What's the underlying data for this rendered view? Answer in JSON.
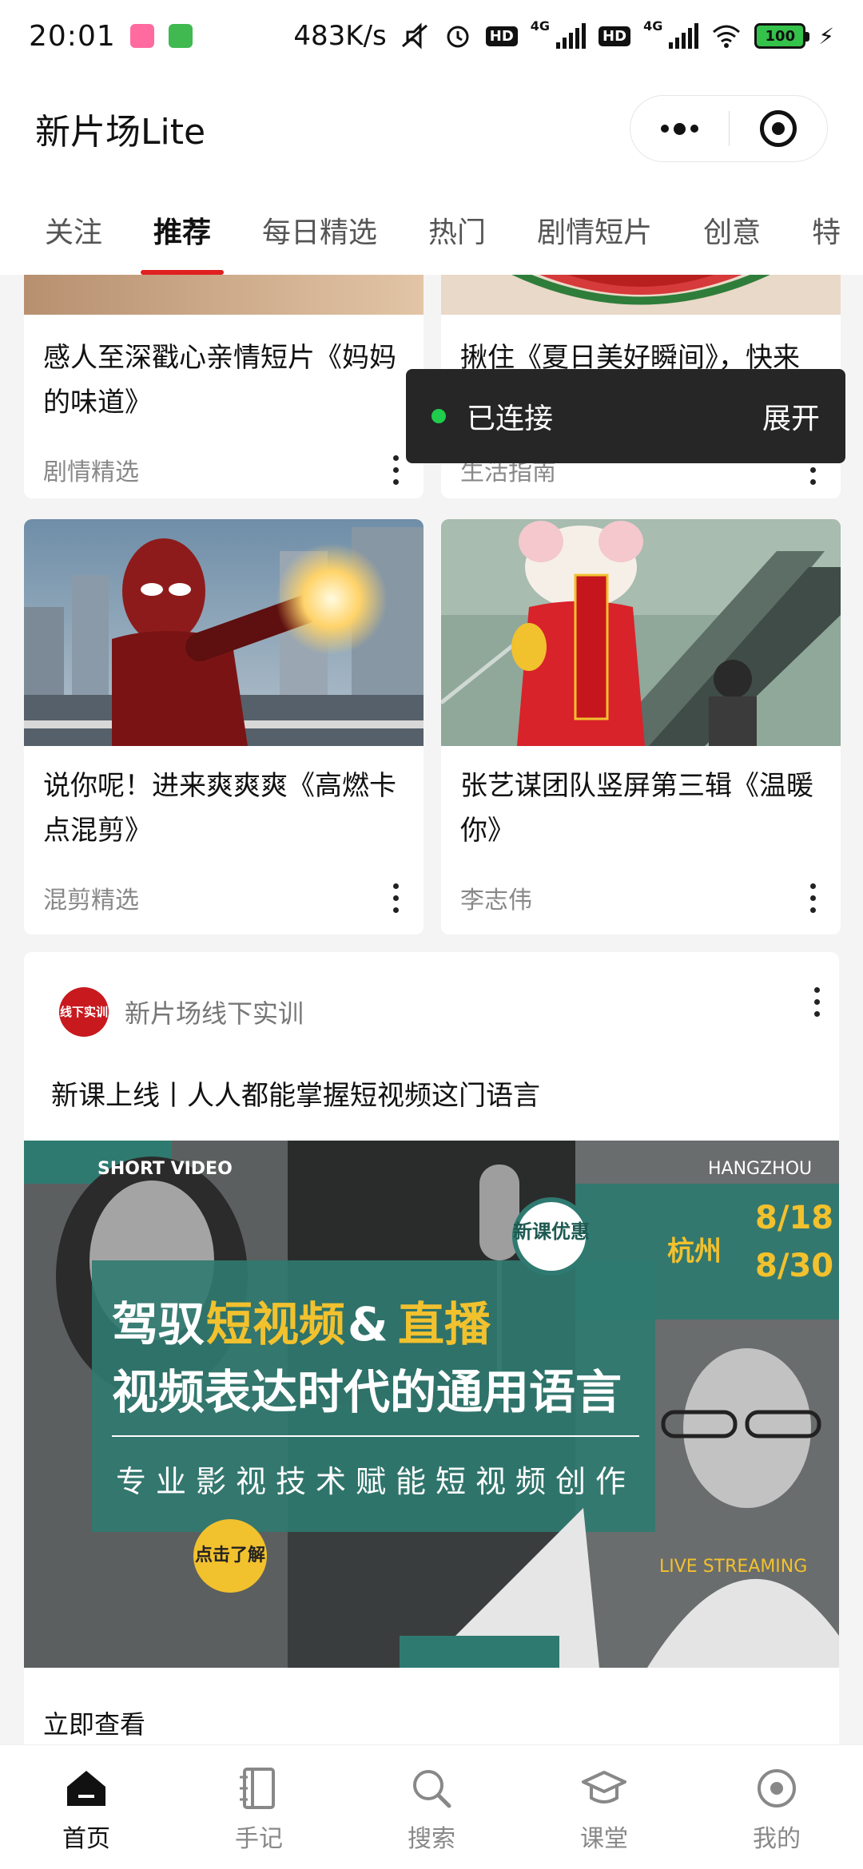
{
  "status_bar": {
    "time": "20:01",
    "net_speed": "483K/s",
    "net_type_1": "4G",
    "net_type_2": "4G",
    "hd_1": "HD",
    "hd_2": "HD",
    "battery": "100"
  },
  "header": {
    "app_title": "新片场Lite"
  },
  "tabs": [
    "关注",
    "推荐",
    "每日精选",
    "热门",
    "剧情短片",
    "创意",
    "特"
  ],
  "active_tab_index": 1,
  "cards": [
    {
      "title": "感人至深戳心亲情短片《妈妈的味道》",
      "author": "剧情精选"
    },
    {
      "title": "揪住《夏日美好瞬间》，快来分享治愈！",
      "author": "生活指南"
    },
    {
      "title": "说你呢！进来爽爽爽《高燃卡点混剪》",
      "author": "混剪精选"
    },
    {
      "title": "张艺谋团队竖屏第三辑《温暖你》",
      "author": "李志伟"
    }
  ],
  "toast": {
    "status": "已连接",
    "action": "展开",
    "dot_color": "#1fcc4b"
  },
  "article": {
    "channel_logo_text": "线下实训",
    "channel_name": "新片场线下实训",
    "title": "新课上线丨人人都能掌握短视频这门语言",
    "link_text": "立即查看",
    "banner": {
      "tag_left": "SHORT VIDEO",
      "tag_right": "HANGZHOU",
      "badge": "新课优惠",
      "city": "杭州",
      "date_start": "8/18",
      "date_end": "8/30",
      "headline_1a": "驾驭",
      "headline_1b": "短视频",
      "headline_1c": "&",
      "headline_1d": "直播",
      "headline_2": "视频表达时代的通用语言",
      "tagline": "专业影视技术赋能短视频创作",
      "cta": "点击了解",
      "live": "LIVE STREAMING"
    }
  },
  "bottom_nav": [
    {
      "label": "首页",
      "icon": "home-icon"
    },
    {
      "label": "手记",
      "icon": "notebook-icon"
    },
    {
      "label": "搜索",
      "icon": "search-icon"
    },
    {
      "label": "课堂",
      "icon": "graduation-cap-icon"
    },
    {
      "label": "我的",
      "icon": "profile-icon"
    }
  ],
  "colors": {
    "accent_red": "#e02020",
    "banner_teal": "#2f7a70",
    "banner_yellow": "#f2c12e"
  }
}
